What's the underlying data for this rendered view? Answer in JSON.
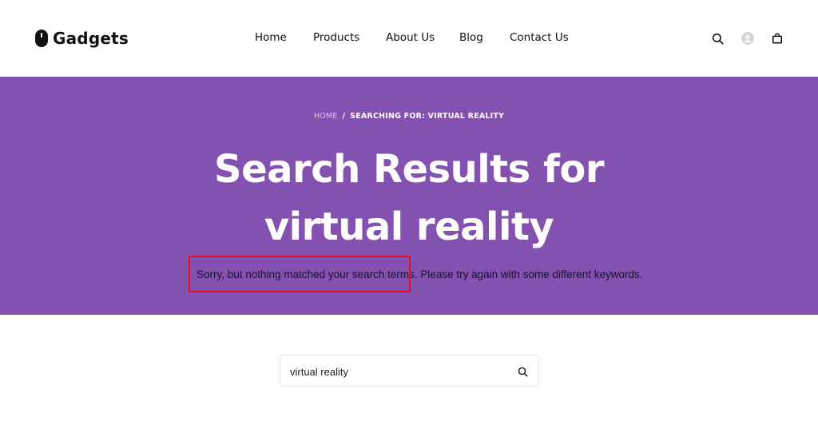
{
  "brand": {
    "name": "Gadgets"
  },
  "nav": {
    "items": [
      {
        "label": "Home"
      },
      {
        "label": "Products"
      },
      {
        "label": "About Us"
      },
      {
        "label": "Blog"
      },
      {
        "label": "Contact Us"
      }
    ]
  },
  "header_icons": [
    "search-icon",
    "avatar",
    "shopping-bag-icon"
  ],
  "breadcrumb": {
    "home": "HOME",
    "separator": "/",
    "current": "SEARCHING FOR: VIRTUAL REALITY"
  },
  "hero": {
    "title_line1": "Search Results for",
    "title_line2": "virtual reality",
    "notice": "Sorry, but nothing matched your search terms. Please try again with some different keywords."
  },
  "search": {
    "value": "virtual reality",
    "button_icon": "search-icon"
  },
  "colors": {
    "hero_bg": "#8352b0",
    "highlight": "#e0102a",
    "text": "#111111"
  }
}
